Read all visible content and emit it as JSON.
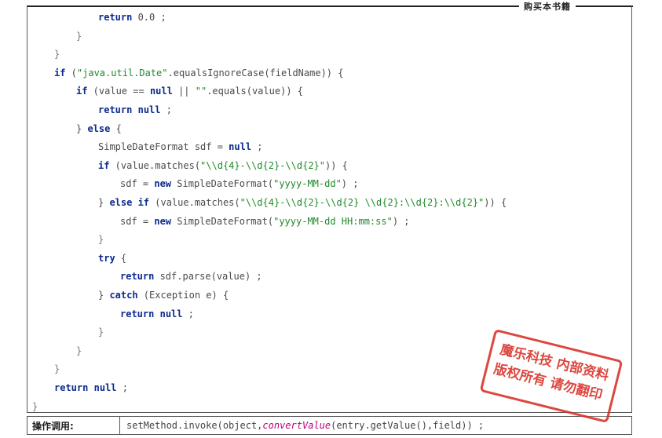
{
  "header": {
    "label": "购买本书籍"
  },
  "code": {
    "lines": [
      {
        "indent": 3,
        "parts": [
          {
            "t": "return",
            "c": "kw"
          },
          {
            "t": " 0.0 ;",
            "c": ""
          }
        ]
      },
      {
        "indent": 2,
        "parts": [
          {
            "t": "}",
            "c": "br"
          }
        ]
      },
      {
        "indent": 1,
        "parts": [
          {
            "t": "}",
            "c": "br"
          }
        ]
      },
      {
        "indent": 1,
        "parts": [
          {
            "t": "if",
            "c": "kw"
          },
          {
            "t": " (",
            "c": ""
          },
          {
            "t": "\"java.util.Date\"",
            "c": "str"
          },
          {
            "t": ".equalsIgnoreCase(fieldName)) {",
            "c": ""
          }
        ]
      },
      {
        "indent": 2,
        "parts": [
          {
            "t": "if",
            "c": "kw"
          },
          {
            "t": " (value == ",
            "c": ""
          },
          {
            "t": "null",
            "c": "kw"
          },
          {
            "t": " || ",
            "c": ""
          },
          {
            "t": "\"\"",
            "c": "str"
          },
          {
            "t": ".equals(value)) {",
            "c": ""
          }
        ]
      },
      {
        "indent": 3,
        "parts": [
          {
            "t": "return",
            "c": "kw"
          },
          {
            "t": " ",
            "c": ""
          },
          {
            "t": "null",
            "c": "kw"
          },
          {
            "t": " ;",
            "c": ""
          }
        ]
      },
      {
        "indent": 2,
        "parts": [
          {
            "t": "} ",
            "c": ""
          },
          {
            "t": "else",
            "c": "kw"
          },
          {
            "t": " {",
            "c": ""
          }
        ]
      },
      {
        "indent": 3,
        "parts": [
          {
            "t": "SimpleDateFormat sdf = ",
            "c": ""
          },
          {
            "t": "null",
            "c": "kw"
          },
          {
            "t": " ;",
            "c": ""
          }
        ]
      },
      {
        "indent": 3,
        "parts": [
          {
            "t": "if",
            "c": "kw"
          },
          {
            "t": " (value.matches(",
            "c": ""
          },
          {
            "t": "\"\\\\d{4}-\\\\d{2}-\\\\d{2}\"",
            "c": "str"
          },
          {
            "t": ")) {",
            "c": ""
          }
        ]
      },
      {
        "indent": 4,
        "parts": [
          {
            "t": "sdf = ",
            "c": ""
          },
          {
            "t": "new",
            "c": "kw"
          },
          {
            "t": " SimpleDateFormat(",
            "c": ""
          },
          {
            "t": "\"yyyy-MM-dd\"",
            "c": "str"
          },
          {
            "t": ") ;",
            "c": ""
          }
        ]
      },
      {
        "indent": 3,
        "parts": [
          {
            "t": "} ",
            "c": ""
          },
          {
            "t": "else if",
            "c": "kw"
          },
          {
            "t": " (value.matches(",
            "c": ""
          },
          {
            "t": "\"\\\\d{4}-\\\\d{2}-\\\\d{2} \\\\d{2}:\\\\d{2}:\\\\d{2}\"",
            "c": "str"
          },
          {
            "t": ")) {",
            "c": ""
          }
        ]
      },
      {
        "indent": 4,
        "parts": [
          {
            "t": "sdf = ",
            "c": ""
          },
          {
            "t": "new",
            "c": "kw"
          },
          {
            "t": " SimpleDateFormat(",
            "c": ""
          },
          {
            "t": "\"yyyy-MM-dd HH:mm:ss\"",
            "c": "str"
          },
          {
            "t": ") ;",
            "c": ""
          }
        ]
      },
      {
        "indent": 3,
        "parts": [
          {
            "t": "}",
            "c": "br"
          }
        ]
      },
      {
        "indent": 3,
        "parts": [
          {
            "t": "try",
            "c": "kw"
          },
          {
            "t": " {",
            "c": ""
          }
        ]
      },
      {
        "indent": 4,
        "parts": [
          {
            "t": "return",
            "c": "kw"
          },
          {
            "t": " sdf.parse(value) ;",
            "c": ""
          }
        ]
      },
      {
        "indent": 3,
        "parts": [
          {
            "t": "} ",
            "c": ""
          },
          {
            "t": "catch",
            "c": "kw"
          },
          {
            "t": " (Exception e) {",
            "c": ""
          }
        ]
      },
      {
        "indent": 4,
        "parts": [
          {
            "t": "return",
            "c": "kw"
          },
          {
            "t": " ",
            "c": ""
          },
          {
            "t": "null",
            "c": "kw"
          },
          {
            "t": " ;",
            "c": ""
          }
        ]
      },
      {
        "indent": 3,
        "parts": [
          {
            "t": "}",
            "c": "br"
          }
        ]
      },
      {
        "indent": 2,
        "parts": [
          {
            "t": "}",
            "c": "br"
          }
        ]
      },
      {
        "indent": 1,
        "parts": [
          {
            "t": "}",
            "c": "br"
          }
        ]
      },
      {
        "indent": 1,
        "parts": [
          {
            "t": "return",
            "c": "kw"
          },
          {
            "t": " ",
            "c": ""
          },
          {
            "t": "null",
            "c": "kw"
          },
          {
            "t": " ;",
            "c": ""
          }
        ]
      },
      {
        "indent": 0,
        "parts": [
          {
            "t": "}",
            "c": "br"
          }
        ]
      }
    ]
  },
  "call_row": {
    "label": "操作调用:",
    "code_prefix": "setMethod.invoke(object,",
    "code_italic": "convertValue",
    "code_suffix": "(entry.getValue(),field)) ;"
  },
  "stamp": {
    "line1": "魔乐科技 内部资料",
    "line2": "版权所有 请勿翻印"
  },
  "colors": {
    "keyword": "#0b2a8c",
    "string": "#1f8a2a",
    "italic_method": "#c0007a",
    "stamp": "#d9342b"
  }
}
